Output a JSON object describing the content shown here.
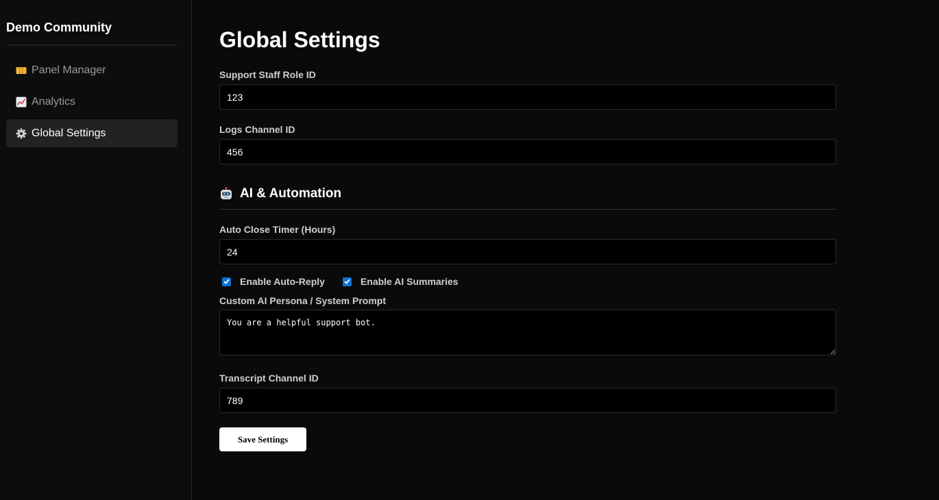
{
  "sidebar": {
    "server_name": "Demo Community",
    "items": [
      {
        "label": "Panel Manager",
        "icon": "ticket-icon"
      },
      {
        "label": "Analytics",
        "icon": "chart-increasing-icon"
      },
      {
        "label": "Global Settings",
        "icon": "gear-icon"
      }
    ],
    "active_item": "Global Settings"
  },
  "main": {
    "title": "Global Settings",
    "fields": {
      "support_role": {
        "label": "Support Staff Role ID",
        "value": "123"
      },
      "logs_channel": {
        "label": "Logs Channel ID",
        "value": "456"
      },
      "auto_close": {
        "label": "Auto Close Timer (Hours)",
        "value": "24"
      },
      "persona": {
        "label": "Custom AI Persona / System Prompt",
        "value": "You are a helpful support bot."
      },
      "transcript": {
        "label": "Transcript Channel ID",
        "value": "789"
      }
    },
    "ai_section": {
      "heading": "AI & Automation",
      "icon": "robot-icon"
    },
    "checkboxes": {
      "auto_reply": {
        "label": "Enable Auto-Reply",
        "checked": true
      },
      "ai_summaries": {
        "label": "Enable AI Summaries",
        "checked": true
      }
    },
    "save_label": "Save Settings"
  },
  "colors": {
    "background": "#0a0a0a",
    "sidebar": "#0d0d0d",
    "active_nav": "#222222",
    "checkbox_accent": "#0b72d8",
    "input_bg": "#000000"
  }
}
